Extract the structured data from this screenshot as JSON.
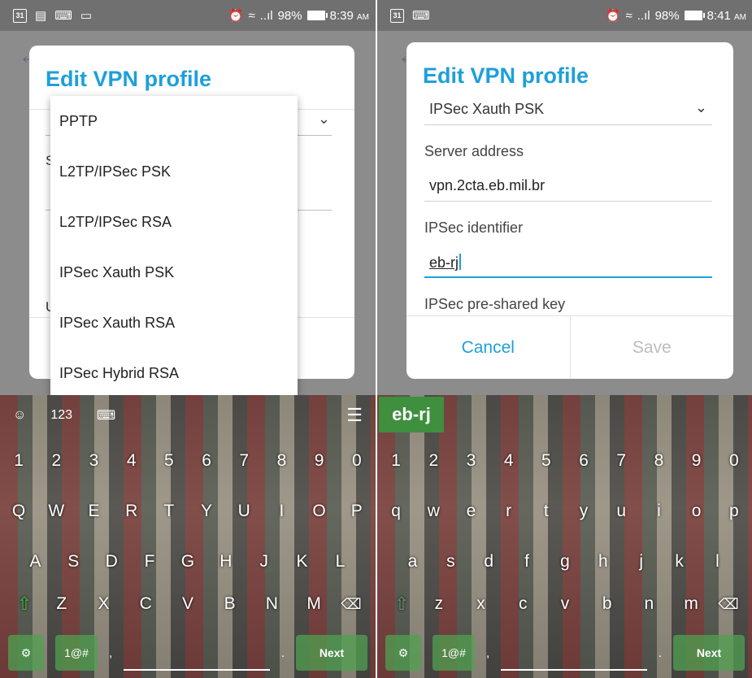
{
  "left": {
    "status": {
      "icons": [
        "calendar-icon",
        "image-icon",
        "keyboard-icon",
        "laptop-icon"
      ],
      "calendar_day": "31",
      "signal_text": "..ıl",
      "battery": "98%",
      "time": "8:39",
      "ampm": "AM"
    },
    "dialog": {
      "title": "Edit VPN profile",
      "stub_s": "S",
      "stub_u": "U"
    },
    "dropdown": {
      "options": [
        "PPTP",
        "L2TP/IPSec PSK",
        "L2TP/IPSec RSA",
        "IPSec Xauth PSK",
        "IPSec Xauth RSA",
        "IPSec Hybrid RSA"
      ]
    },
    "keyboard": {
      "mode": "123",
      "rows": [
        [
          "1",
          "2",
          "3",
          "4",
          "5",
          "6",
          "7",
          "8",
          "9",
          "0"
        ],
        [
          "Q",
          "W",
          "E",
          "R",
          "T",
          "Y",
          "U",
          "I",
          "O",
          "P"
        ],
        [
          "A",
          "S",
          "D",
          "F",
          "G",
          "H",
          "J",
          "K",
          "L"
        ],
        [
          "Z",
          "X",
          "C",
          "V",
          "B",
          "N",
          "M"
        ]
      ],
      "symbols_label": "1@#",
      "comma": ",",
      "period": ".",
      "next_label": "Next"
    }
  },
  "right": {
    "status": {
      "calendar_day": "31",
      "signal_text": "..ıl",
      "battery": "98%",
      "time": "8:41",
      "ampm": "AM"
    },
    "dialog": {
      "title": "Edit VPN profile",
      "type_value": "IPSec Xauth PSK",
      "server_label": "Server address",
      "server_value": "vpn.2cta.eb.mil.br",
      "ipsec_id_label": "IPSec identifier",
      "ipsec_id_value": "eb-rj",
      "psk_label": "IPSec pre-shared key",
      "cancel_label": "Cancel",
      "save_label": "Save"
    },
    "keyboard": {
      "suggestion": "eb-rj",
      "rows": [
        [
          "1",
          "2",
          "3",
          "4",
          "5",
          "6",
          "7",
          "8",
          "9",
          "0"
        ],
        [
          "q",
          "w",
          "e",
          "r",
          "t",
          "y",
          "u",
          "i",
          "o",
          "p"
        ],
        [
          "a",
          "s",
          "d",
          "f",
          "g",
          "h",
          "j",
          "k",
          "l"
        ],
        [
          "z",
          "x",
          "c",
          "v",
          "b",
          "n",
          "m"
        ]
      ],
      "symbols_label": "1@#",
      "comma": ",",
      "period": ".",
      "next_label": "Next"
    }
  }
}
